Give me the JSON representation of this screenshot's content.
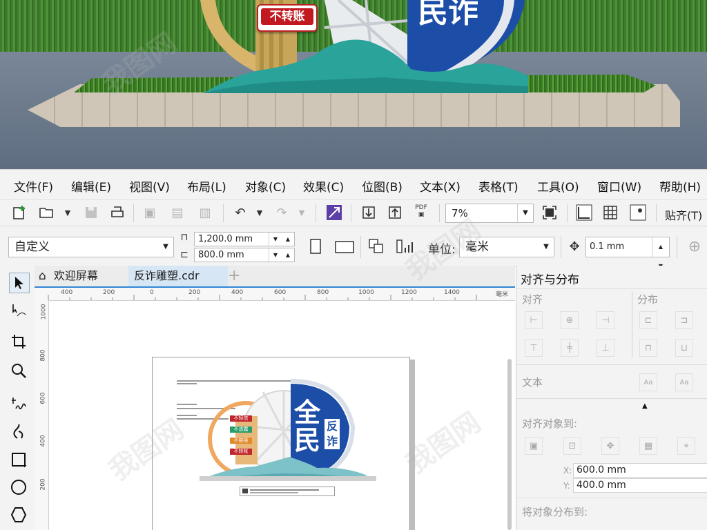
{
  "photo": {
    "badge_text": "不转账",
    "sign_text": "民诈"
  },
  "menu": [
    {
      "label": "文件(F)"
    },
    {
      "label": "编辑(E)"
    },
    {
      "label": "视图(V)"
    },
    {
      "label": "布局(L)"
    },
    {
      "label": "对象(C)"
    },
    {
      "label": "效果(C)"
    },
    {
      "label": "位图(B)"
    },
    {
      "label": "文本(X)"
    },
    {
      "label": "表格(T)"
    },
    {
      "label": "工具(O)"
    },
    {
      "label": "窗口(W)"
    },
    {
      "label": "帮助(H)"
    }
  ],
  "toolbar1": {
    "zoom_value": "7%",
    "snap_label": "贴齐(T)",
    "pdf_label": "PDF"
  },
  "toolbar2": {
    "page_preset": "自定义",
    "width_value": "1,200.0 mm",
    "height_value": "800.0 mm",
    "unit_label": "单位:",
    "unit_value": "毫米",
    "nudge_value": "0.1 mm"
  },
  "tabs": {
    "welcome": "欢迎屏幕",
    "document": "反诈雕塑.cdr",
    "add": "+"
  },
  "ruler": {
    "h_ticks": [
      "400",
      "200",
      "0",
      "200",
      "400",
      "600",
      "800",
      "1000",
      "1200",
      "1400"
    ],
    "h_unit": "毫米",
    "v_ticks": [
      "1000",
      "800",
      "600",
      "400",
      "200"
    ]
  },
  "design": {
    "big_top": "全",
    "big_bottom": "民",
    "small_top": "反",
    "small_bottom": "诈",
    "strips": [
      "不轻信",
      "不透露",
      "不链接",
      "不转账"
    ]
  },
  "docker": {
    "title": "对齐与分布",
    "align": "对齐",
    "distribute": "分布",
    "text": "文本",
    "align_to": "对齐对象到:",
    "x_label": "X:",
    "x_value": "600.0 mm",
    "y_label": "Y:",
    "y_value": "400.0 mm",
    "distribute_to": "将对象分布到:"
  },
  "colors": {
    "accent": "#2f86d6",
    "sign_blue": "#1c4ea8",
    "hill_teal": "#3aa8a0",
    "ring_orange": "#f0a860"
  }
}
